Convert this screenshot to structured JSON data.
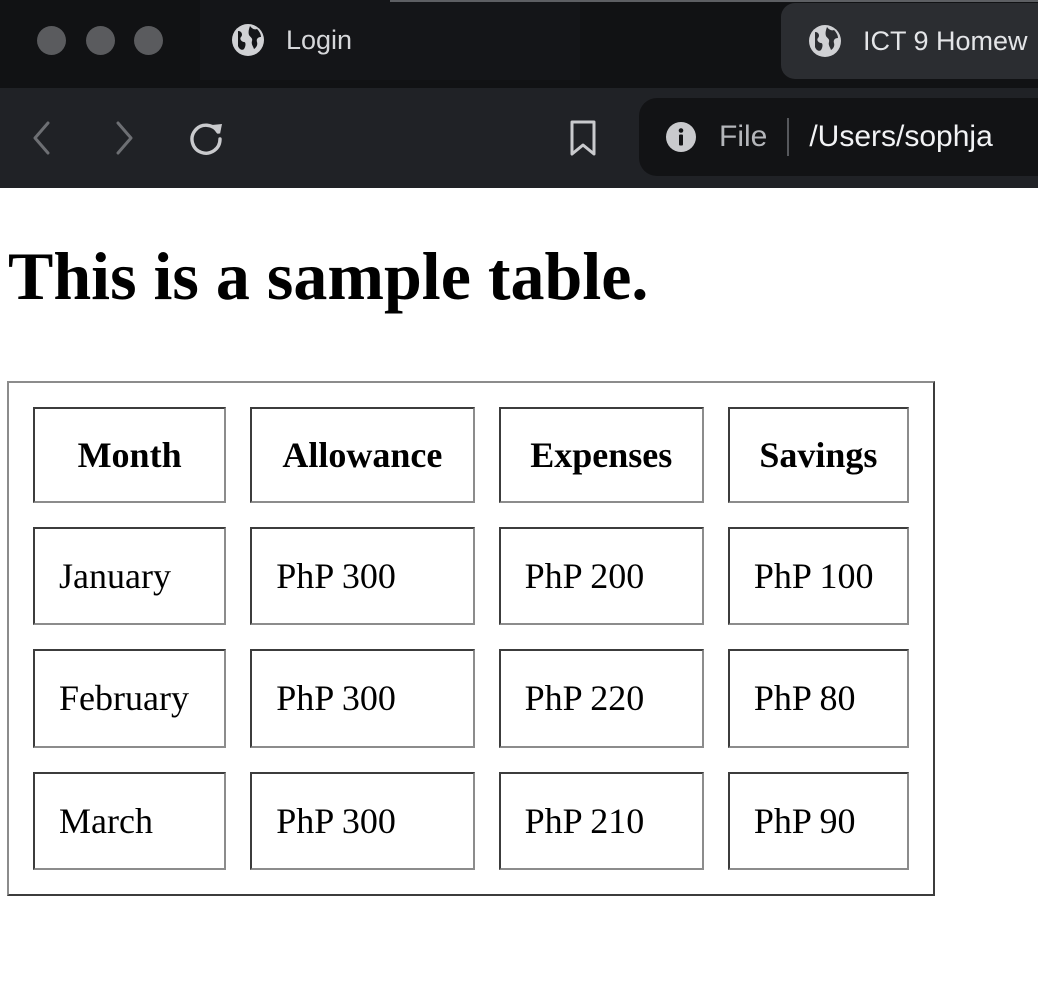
{
  "browser": {
    "tabs": [
      {
        "title": "Login",
        "active": false,
        "icon": "globe-icon"
      },
      {
        "title": "ICT 9 Homew",
        "active": true,
        "icon": "globe-icon"
      }
    ],
    "toolbar": {
      "back_icon": "chevron-left-icon",
      "forward_icon": "chevron-right-icon",
      "reload_icon": "reload-icon",
      "bookmark_icon": "bookmark-icon"
    },
    "address": {
      "info_icon": "info-icon",
      "scheme": "File",
      "path": "/Users/sophja"
    },
    "colors": {
      "tabbar_bg": "#111214",
      "toolbar_bg": "#202226",
      "urlbar_bg": "#121315"
    }
  },
  "page": {
    "heading": "This is a sample table.",
    "table": {
      "headers": [
        "Month",
        "Allowance",
        "Expenses",
        "Savings"
      ],
      "rows": [
        [
          "January",
          "PhP 300",
          "PhP 200",
          "PhP 100"
        ],
        [
          "February",
          "PhP 300",
          "PhP 220",
          "PhP 80"
        ],
        [
          "March",
          "PhP 300",
          "PhP 210",
          "PhP 90"
        ]
      ]
    }
  }
}
